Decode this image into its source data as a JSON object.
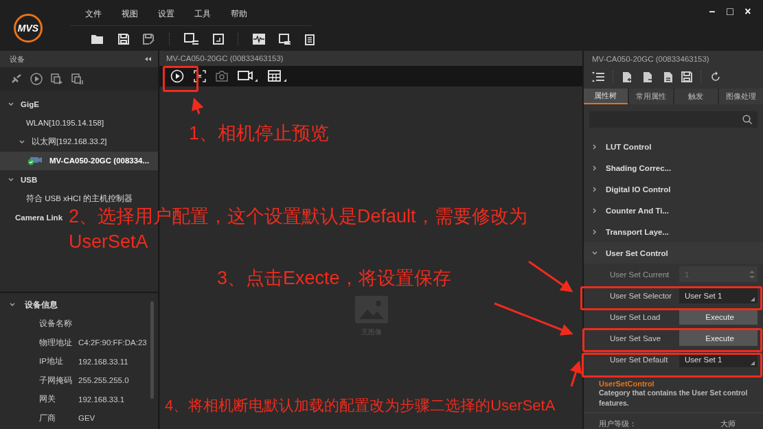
{
  "app": {
    "logo": "MVS",
    "menu": [
      "文件",
      "视图",
      "设置",
      "工具",
      "帮助"
    ],
    "window_controls": [
      "–",
      "□",
      "×"
    ]
  },
  "device_panel": {
    "title": "设备",
    "tree": [
      {
        "label": "GigE",
        "expanded": true,
        "selected": false,
        "children": [
          {
            "label": "WLAN[10.195.14.158]",
            "selected": false
          },
          {
            "label": "以太网[192.168.33.2]",
            "expanded": true,
            "selected": false,
            "children": [
              {
                "label": "MV-CA050-20GC (008334...",
                "selected": true,
                "kind": "camera"
              }
            ]
          }
        ]
      },
      {
        "label": "USB",
        "expanded": true,
        "selected": false,
        "children": [
          {
            "label": "符合 USB xHCI 的主机控制器",
            "selected": false
          }
        ]
      },
      {
        "label": "Camera Link",
        "selected": false
      }
    ],
    "info": {
      "title": "设备信息",
      "expanded": true,
      "fields": [
        {
          "label": "设备名称"
        },
        {
          "label": "物理地址",
          "value": "C4:2F:90:FF:DA:23"
        },
        {
          "label": "IP地址",
          "value": "192.168.33.11"
        },
        {
          "label": "子网掩码",
          "value": "255.255.255.0"
        },
        {
          "label": "网关",
          "value": "192.168.33.1"
        },
        {
          "label": "厂商",
          "value": "GEV"
        }
      ]
    }
  },
  "preview": {
    "title": "MV-CA050-20GC (00833463153)",
    "empty_label": "无图像"
  },
  "properties": {
    "title": "MV-CA050-20GC (00833463153)",
    "tabs": [
      {
        "label": "属性树",
        "selected": true
      },
      {
        "label": "常用属性",
        "selected": false
      },
      {
        "label": "触发",
        "selected": false
      },
      {
        "label": "图像处理",
        "selected": false
      }
    ],
    "tree": [
      {
        "label": "LUT Control",
        "expanded": false
      },
      {
        "label": "Shading Correc...",
        "expanded": false
      },
      {
        "label": "Digital IO Control",
        "expanded": false
      },
      {
        "label": "Counter And Ti...",
        "expanded": false
      },
      {
        "label": "Transport Laye...",
        "expanded": false
      },
      {
        "label": "User Set Control",
        "expanded": true,
        "children": [
          {
            "label": "User Set Current",
            "kind": "number",
            "value": "1",
            "disabled": true
          },
          {
            "label": "User Set Selector",
            "kind": "select",
            "value": "User Set 1",
            "disabled": false
          },
          {
            "label": "User Set Load",
            "kind": "button",
            "value": "Execute",
            "disabled": false
          },
          {
            "label": "User Set Save",
            "kind": "button",
            "value": "Execute",
            "disabled": false
          },
          {
            "label": "User Set Default",
            "kind": "select",
            "value": "User Set 1",
            "disabled": false
          }
        ]
      }
    ],
    "description": {
      "title": "UserSetControl",
      "text": "Category that contains the User Set control features."
    },
    "user_level": {
      "label": "用户等级：",
      "value": "大师"
    }
  },
  "annotations": [
    "1、相机停止预览",
    "2、选择用户配置，这个设置默认是Default，需要修改为UserSetA",
    "3、点击Execte，将设置保存",
    "4、将相机断电默认加载的配置改为步骤二选择的UserSetA"
  ]
}
